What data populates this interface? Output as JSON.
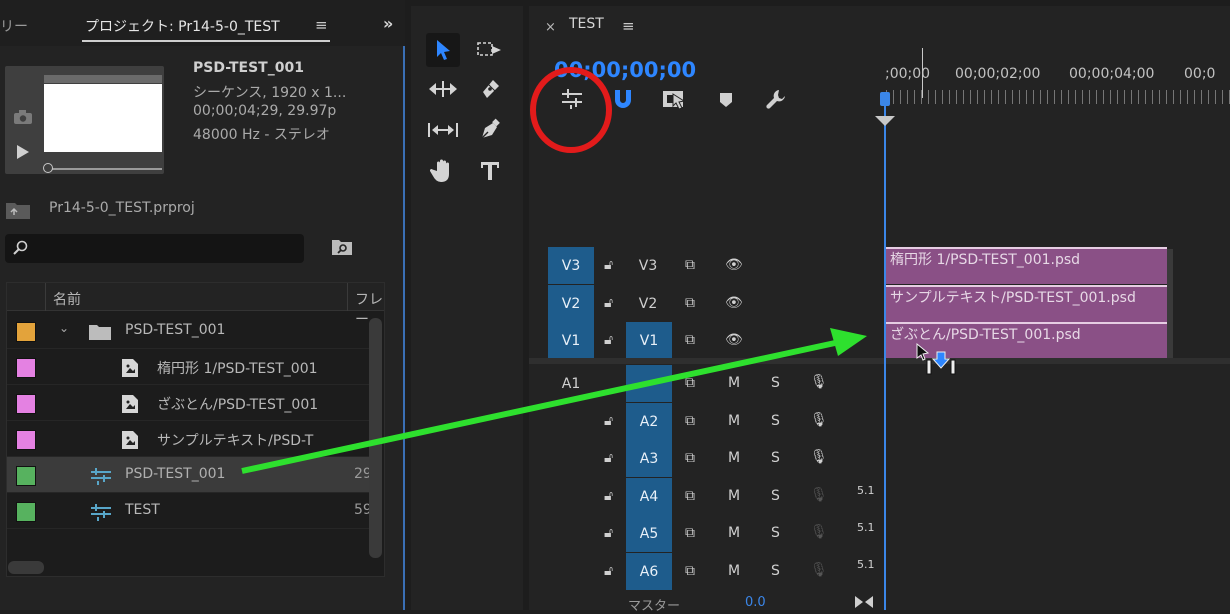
{
  "project_panel": {
    "prev_tab_fragment": "リー",
    "tab_title": "プロジェクト: Pr14-5-0_TEST",
    "menu_glyph": "≡",
    "overflow_glyph": "»",
    "preview": {
      "name": "PSD-TEST_001",
      "line1": "シーケンス, 1920 x 1...",
      "line2": "00;00;04;29, 29.97p",
      "line3": "48000 Hz - ステレオ"
    },
    "project_file": "Pr14-5-0_TEST.prproj",
    "search_placeholder": "",
    "columns": {
      "name": "名前",
      "frame": "フレー"
    },
    "items": [
      {
        "label": "PSD-TEST_001",
        "color": "#e3a33b",
        "type": "bin",
        "frame": ""
      },
      {
        "label": "楕円形 1/PSD-TEST_001",
        "color": "#e481e2",
        "type": "psd-layer",
        "frame": ""
      },
      {
        "label": "ざぶとん/PSD-TEST_001",
        "color": "#e481e2",
        "type": "psd-layer",
        "frame": ""
      },
      {
        "label": "サンプルテキスト/PSD-T",
        "color": "#e481e2",
        "type": "psd-layer",
        "frame": ""
      },
      {
        "label": "PSD-TEST_001",
        "color": "#57b25f",
        "type": "sequence",
        "frame": "29"
      },
      {
        "label": "TEST",
        "color": "#57b25f",
        "type": "sequence",
        "frame": "59"
      }
    ]
  },
  "tools": [
    "selection-tool",
    "track-select-tool",
    "ripple-edit-tool",
    "razor-tool",
    "slip-tool",
    "pen-tool",
    "hand-tool",
    "type-tool"
  ],
  "timeline": {
    "close_glyph": "×",
    "sequence_name": "TEST",
    "menu_glyph": "≡",
    "timecode": "00;00;00;00",
    "ruler_labels": [
      ";00;00",
      "00;00;02;00",
      "00;00;04;00",
      "00;0"
    ],
    "video_tracks": [
      {
        "src": "V3",
        "name": "V3",
        "clip": "楕円形 1/PSD-TEST_001.psd"
      },
      {
        "src": "V2",
        "name": "V2",
        "clip": "サンプルテキスト/PSD-TEST_001.psd"
      },
      {
        "src": "V1",
        "name": "V1",
        "clip": "ざぶとん/PSD-TEST_001.psd"
      }
    ],
    "audio_tracks": [
      {
        "src": "A1",
        "name": "A1",
        "channel": ""
      },
      {
        "src": "",
        "name": "A2",
        "channel": ""
      },
      {
        "src": "",
        "name": "A3",
        "channel": ""
      },
      {
        "src": "",
        "name": "A4",
        "channel": "5.1"
      },
      {
        "src": "",
        "name": "A5",
        "channel": "5.1"
      },
      {
        "src": "",
        "name": "A6",
        "channel": "5.1"
      }
    ],
    "mute_label": "M",
    "solo_label": "S",
    "master_label": "マスター",
    "master_value": "0.0"
  },
  "annotation_colors": {
    "circle": "#e21b1b",
    "arrow": "#2ee02e",
    "label_purple": "#8a5086"
  }
}
